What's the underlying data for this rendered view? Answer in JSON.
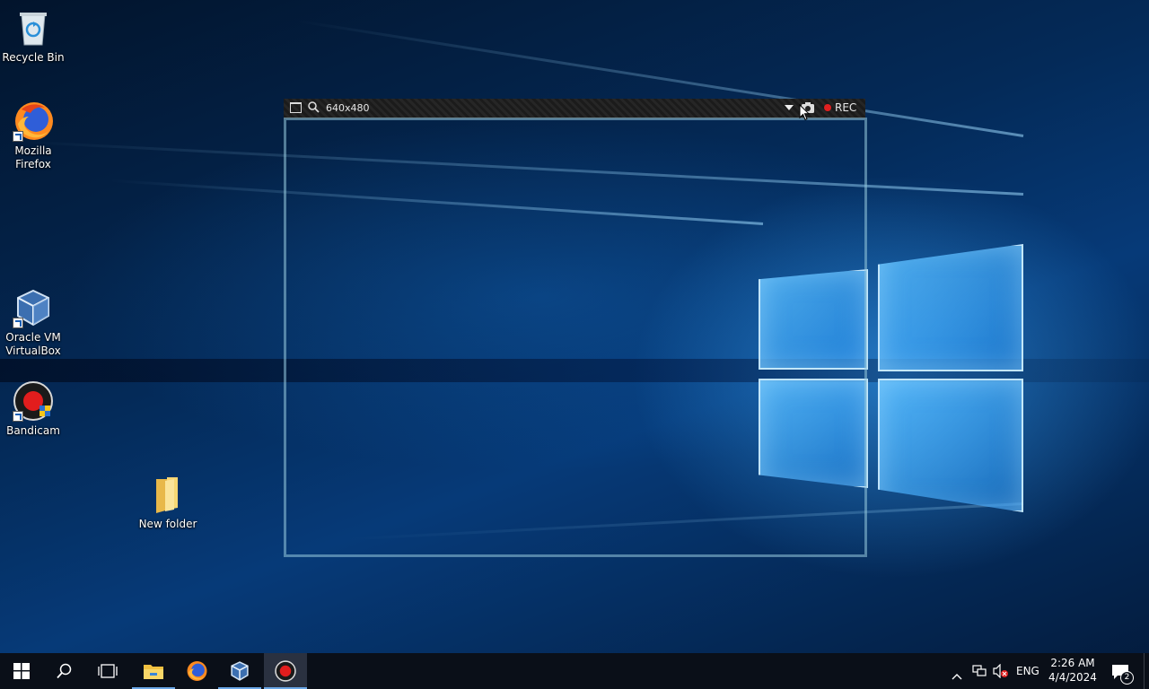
{
  "desktop": {
    "icons": [
      {
        "label_line1": "Recycle Bin",
        "label_line2": "",
        "icon": "recycle-bin-icon"
      },
      {
        "label_line1": "Mozilla",
        "label_line2": "Firefox",
        "icon": "firefox-icon"
      },
      {
        "label_line1": "Oracle VM",
        "label_line2": "VirtualBox",
        "icon": "virtualbox-icon"
      },
      {
        "label_line1": "Bandicam",
        "label_line2": "",
        "icon": "bandicam-icon"
      },
      {
        "label_line1": "New folder",
        "label_line2": "",
        "icon": "folder-icon"
      }
    ]
  },
  "capture": {
    "resolution": "640x480",
    "rec_label": "REC",
    "rec_color": "#e02020",
    "frame_color": "#96c8dc"
  },
  "taskbar": {
    "apps": [
      "start-icon",
      "search-icon",
      "task-view-icon",
      "file-explorer-icon",
      "firefox-icon",
      "virtualbox-icon",
      "bandicam-icon"
    ],
    "tray": {
      "language": "ENG",
      "time": "2:26 AM",
      "date": "4/4/2024",
      "notification_count": "2"
    },
    "accent": "#6aa6e6"
  }
}
